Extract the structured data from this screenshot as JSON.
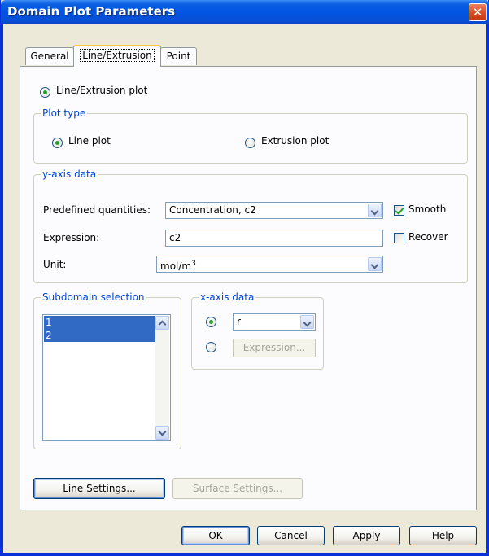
{
  "window": {
    "title": "Domain Plot Parameters",
    "close_glyph": "✕"
  },
  "tabs": [
    {
      "label": "General"
    },
    {
      "label": "Line/Extrusion"
    },
    {
      "label": "Point"
    }
  ],
  "plot_mode": {
    "label": "Line/Extrusion plot"
  },
  "plot_type": {
    "title": "Plot type",
    "line_plot": "Line plot",
    "extrusion_plot": "Extrusion plot"
  },
  "y_axis": {
    "title": "y-axis data",
    "predefined_label": "Predefined quantities:",
    "predefined_value": "Concentration, c2",
    "smooth_label": "Smooth",
    "expression_label": "Expression:",
    "expression_value": "c2",
    "recover_label": "Recover",
    "unit_label": "Unit:",
    "unit_base": "mol/m",
    "unit_exp": "3"
  },
  "subdomain": {
    "title": "Subdomain selection",
    "items": [
      "1",
      "2"
    ]
  },
  "x_axis": {
    "title": "x-axis data",
    "var_value": "r",
    "expression_button": "Expression..."
  },
  "settings_buttons": {
    "line": "Line Settings...",
    "surface": "Surface Settings..."
  },
  "footer": {
    "ok": "OK",
    "cancel": "Cancel",
    "apply": "Apply",
    "help": "Help"
  }
}
